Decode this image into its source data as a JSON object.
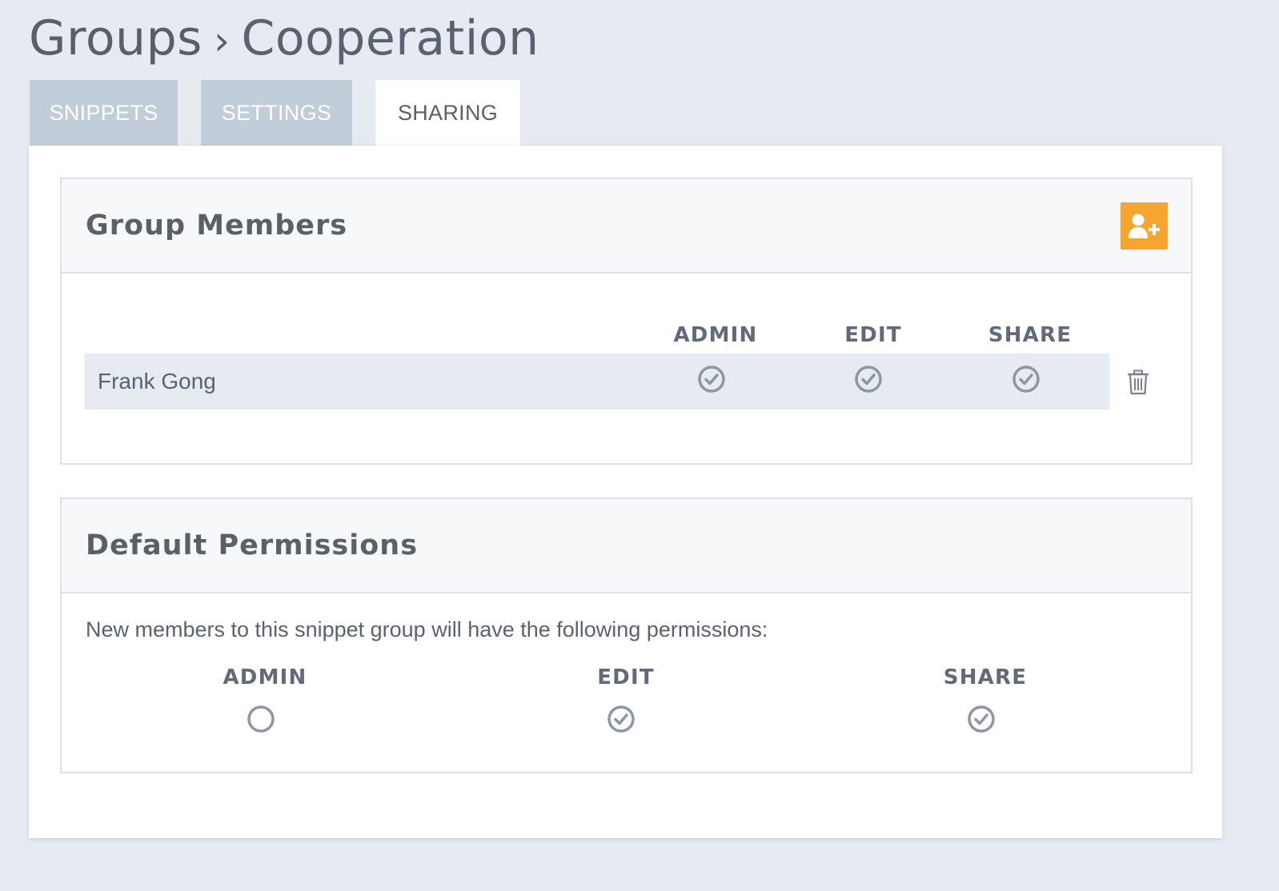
{
  "breadcrumb": {
    "parent": "Groups",
    "separator": "›",
    "current": "Cooperation"
  },
  "tabs": [
    {
      "label": "SNIPPETS",
      "active": false
    },
    {
      "label": "SETTINGS",
      "active": false
    },
    {
      "label": "SHARING",
      "active": true
    }
  ],
  "group_members": {
    "title": "Group Members",
    "add_icon": "add-user-icon",
    "columns": [
      "ADMIN",
      "EDIT",
      "SHARE"
    ],
    "members": [
      {
        "name": "Frank Gong",
        "admin": true,
        "edit": true,
        "share": true
      }
    ],
    "delete_icon": "trash-icon"
  },
  "default_permissions": {
    "title": "Default Permissions",
    "description": "New members to this snippet group will have the following permissions:",
    "columns": [
      "ADMIN",
      "EDIT",
      "SHARE"
    ],
    "values": {
      "admin": false,
      "edit": true,
      "share": true
    }
  },
  "colors": {
    "background": "#e6ebf2",
    "tab_inactive": "#c2cdda",
    "accent_orange": "#f7a531",
    "icon_gray": "#8e95a3"
  }
}
